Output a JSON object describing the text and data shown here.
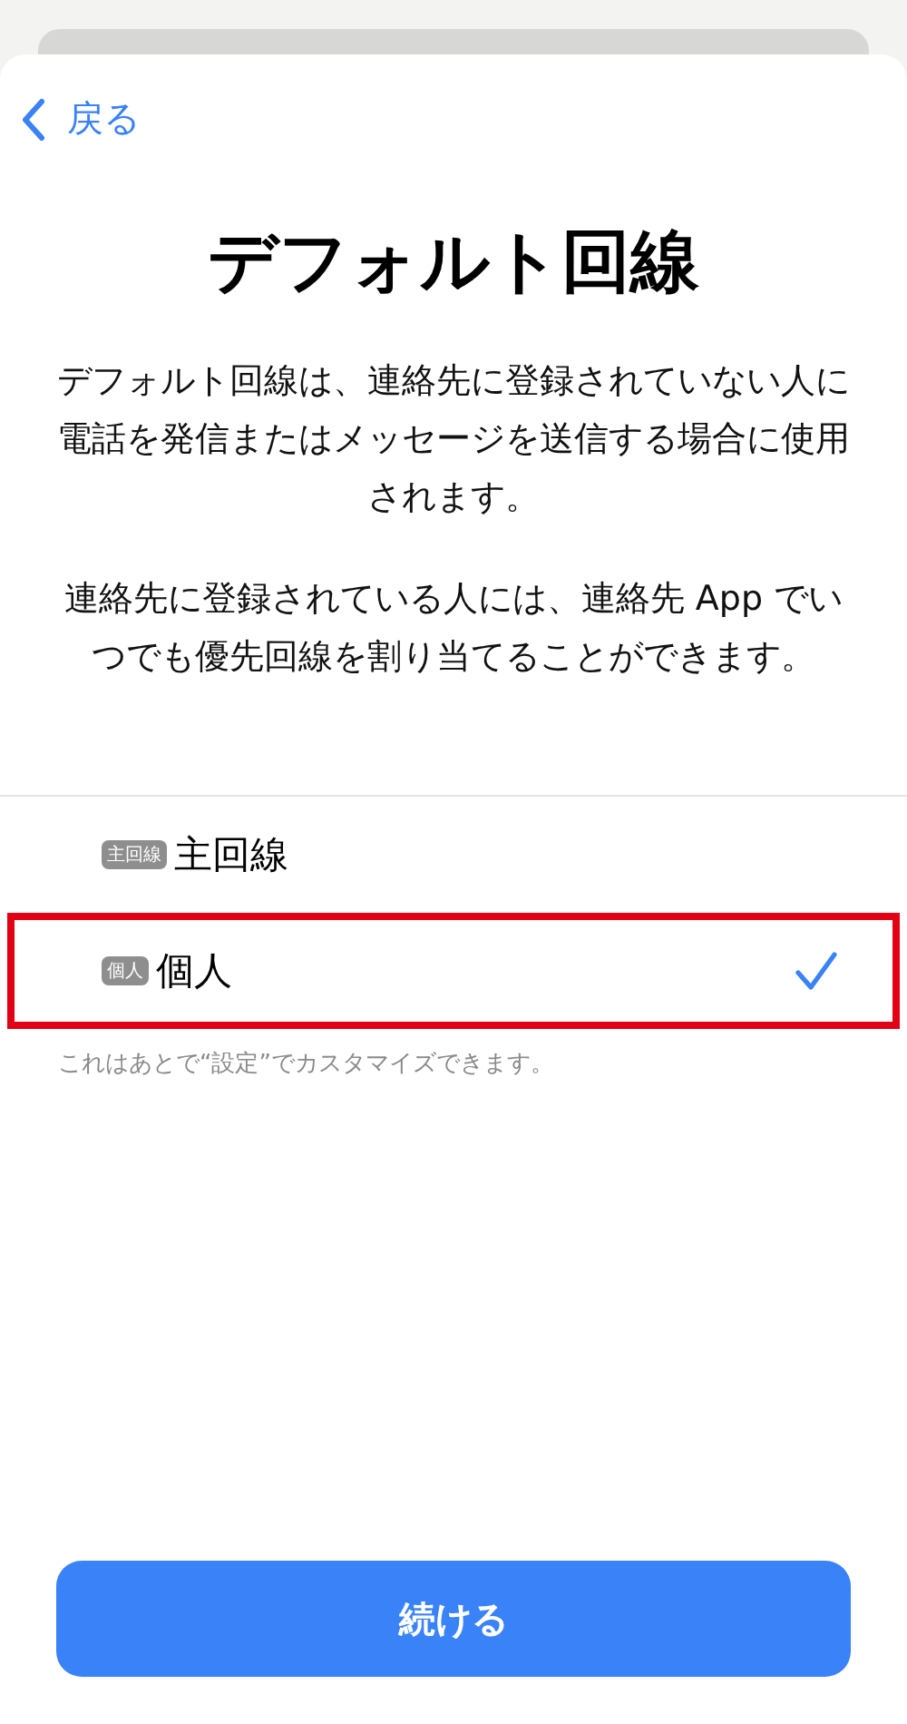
{
  "back_button": {
    "label": "戻る"
  },
  "title": "デフォルト回線",
  "paragraphs": [
    "デフォルト回線は、連絡先に登録されていない人に電話を発信またはメッセージを送信する場合に使用されます。",
    "連絡先に登録されている人には、連絡先 App でいつでも優先回線を割り当てることができます。"
  ],
  "lines": [
    {
      "badge": "主回線",
      "label": "主回線",
      "selected": false,
      "highlighted": false
    },
    {
      "badge": "個人",
      "label": "個人",
      "selected": true,
      "highlighted": true
    }
  ],
  "footnote": "これはあとで“設定”でカスタマイズできます。",
  "continue_button": {
    "label": "続ける"
  }
}
